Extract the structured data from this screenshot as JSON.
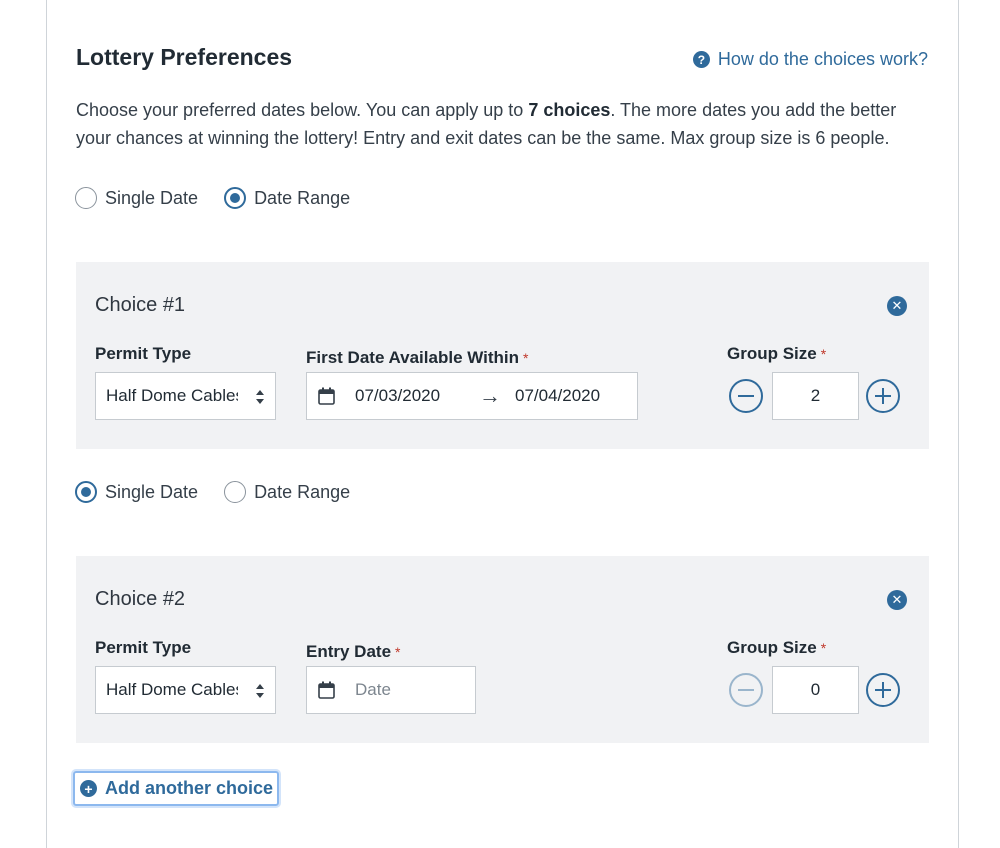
{
  "header": {
    "title": "Lottery Preferences",
    "help_link": "How do the choices work?",
    "help_icon": "?"
  },
  "description": {
    "part1": "Choose your preferred dates below. You can apply up to ",
    "bold": "7 choices",
    "part2": ". The more dates you add the better your chances at winning the lottery! Entry and exit dates can be the same. Max group size is 6 people."
  },
  "date_mode_top": {
    "options": [
      "Single Date",
      "Date Range"
    ],
    "selected": "Date Range"
  },
  "choice1": {
    "title": "Choice #1",
    "permit_label": "Permit Type",
    "permit_value": "Half Dome Cables",
    "date_label": "First Date Available Within",
    "start_date": "07/03/2020",
    "end_date": "07/04/2020",
    "group_label": "Group Size",
    "group_value": "2",
    "required_mark": "*"
  },
  "date_mode_mid": {
    "options": [
      "Single Date",
      "Date Range"
    ],
    "selected": "Single Date"
  },
  "choice2": {
    "title": "Choice #2",
    "permit_label": "Permit Type",
    "permit_value": "Half Dome Cables",
    "date_label": "Entry Date",
    "date_placeholder": "Date",
    "group_label": "Group Size",
    "group_value": "0",
    "required_mark": "*"
  },
  "add_choice": {
    "label": "Add another choice",
    "icon": "+"
  },
  "colors": {
    "accent": "#2f6a9b",
    "panel_bg": "#f1f2f4",
    "required": "#c0392b"
  }
}
